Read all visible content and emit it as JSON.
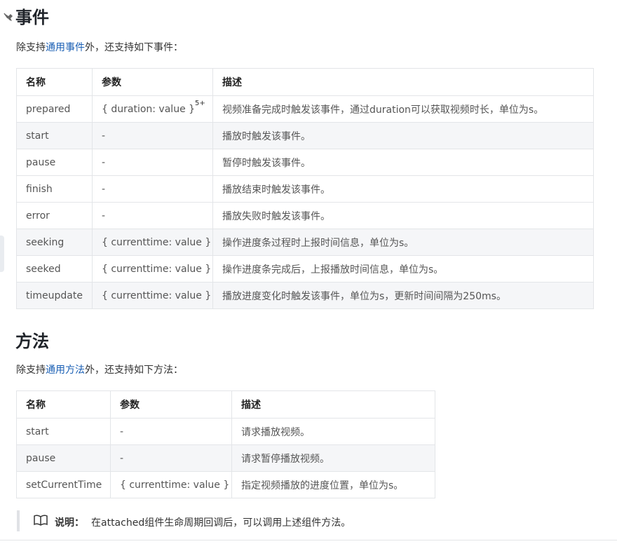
{
  "events": {
    "title": "事件",
    "intro_pre": "除支持",
    "intro_link": "通用事件",
    "intro_post": "外，还支持如下事件：",
    "headers": [
      "名称",
      "参数",
      "描述"
    ],
    "rows": [
      {
        "name": "prepared",
        "param": "{ duration: value }",
        "sup": "5+",
        "desc": "视频准备完成时触发该事件，通过duration可以获取视频时长，单位为s。"
      },
      {
        "name": "start",
        "param": "-",
        "desc": "播放时触发该事件。"
      },
      {
        "name": "pause",
        "param": "-",
        "desc": "暂停时触发该事件。"
      },
      {
        "name": "finish",
        "param": "-",
        "desc": "播放结束时触发该事件。"
      },
      {
        "name": "error",
        "param": "-",
        "desc": "播放失败时触发该事件。"
      },
      {
        "name": "seeking",
        "param": "{ currenttime: value }",
        "desc": "操作进度条过程时上报时间信息，单位为s。"
      },
      {
        "name": "seeked",
        "param": "{ currenttime: value }",
        "desc": "操作进度条完成后，上报播放时间信息，单位为s。"
      },
      {
        "name": "timeupdate",
        "param": "{ currenttime: value }",
        "desc": "播放进度变化时触发该事件，单位为s，更新时间间隔为250ms。"
      }
    ]
  },
  "methods": {
    "title": "方法",
    "intro_pre": "除支持",
    "intro_link": "通用方法",
    "intro_post": "外，还支持如下方法：",
    "headers": [
      "名称",
      "参数",
      "描述"
    ],
    "rows": [
      {
        "name": "start",
        "param": "-",
        "desc": "请求播放视频。"
      },
      {
        "name": "pause",
        "param": "-",
        "desc": "请求暂停播放视频。"
      },
      {
        "name": "setCurrentTime",
        "param": "{ currenttime: value }",
        "desc": "指定视频播放的进度位置，单位为s。"
      }
    ]
  },
  "note": {
    "icon": "book-icon",
    "label": "说明：",
    "text": "在attached组件生命周期回调后，可以调用上述组件方法。"
  },
  "icons": {
    "anchor": "pin-icon"
  }
}
